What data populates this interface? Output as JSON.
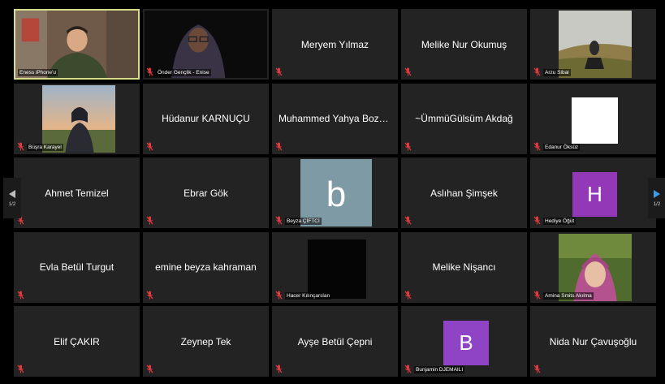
{
  "navigation": {
    "left_page": "1/2",
    "right_page": "1/2"
  },
  "participants": [
    {
      "label": "Eness iPhone'u"
    },
    {
      "label": "Önder Gençlik - Enise"
    },
    {
      "name": "Meryem Yılmaz"
    },
    {
      "name": "Melike Nur Okumuş"
    },
    {
      "label": "Arzu Sibal"
    },
    {
      "label": "Büşra Karayel"
    },
    {
      "name": "Hüdanur KARNUÇU"
    },
    {
      "name": "Muhammed Yahya Bozdoğ..."
    },
    {
      "name": "~ÜmmüGülsüm Akdağ"
    },
    {
      "label": "Edanur Öksüz"
    },
    {
      "name": "Ahmet Temizel"
    },
    {
      "name": "Ebrar Gök"
    },
    {
      "label": "Beyza ÇİFTCİ",
      "avatar_letter": "b",
      "avatar_color": "#7e9aa4"
    },
    {
      "name": "Aslıhan Şimşek"
    },
    {
      "label": "Hediye Öğüt",
      "avatar_letter": "H",
      "avatar_color": "#9339b8"
    },
    {
      "name": "Evla Betül Turgut"
    },
    {
      "name": "emine beyza kahraman"
    },
    {
      "label": "Hacer Kılınçarslan"
    },
    {
      "name": "Melike Nişancı"
    },
    {
      "label": "Amina Smits Akılma"
    },
    {
      "name": "Elif ÇAKIR"
    },
    {
      "name": "Zeynep Tek"
    },
    {
      "name": "Ayşe Betül Çepni"
    },
    {
      "label": "Bunjamin DJEMAILI",
      "avatar_letter": "B",
      "avatar_color": "#8e44c4"
    },
    {
      "name": "Nida Nur Çavuşoğlu"
    }
  ],
  "colors": {
    "active_speaker_border": "#d6dd87",
    "tile_bg": "#232323",
    "muted_icon": "#e0393e"
  }
}
